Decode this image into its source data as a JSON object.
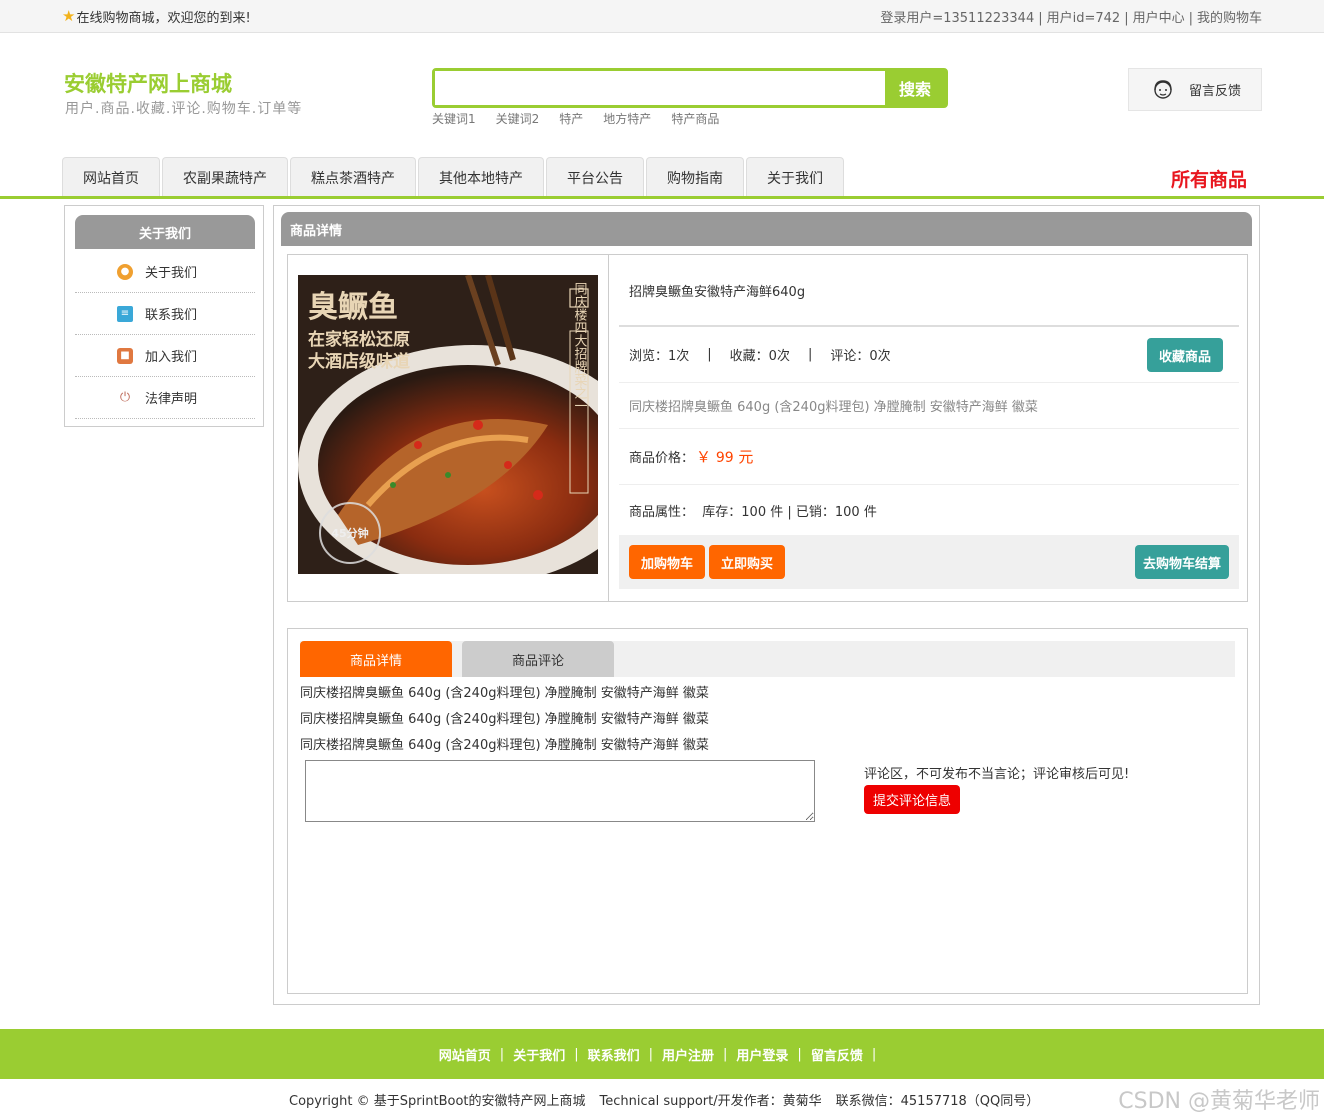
{
  "topbar": {
    "welcome": "在线购物商城，欢迎您的到来!",
    "links": [
      "登录用户=13511223344",
      "用户id=742",
      "用户中心",
      "我的购物车"
    ]
  },
  "header": {
    "title": "安徽特产网上商城",
    "subtitle": "用户.商品.收藏.评论.购物车.订单等",
    "search_value": "",
    "search_button": "搜索",
    "keywords": [
      "关键词1",
      "关键词2",
      "特产",
      "地方特产",
      "特产商品"
    ],
    "feedback": "留言反馈"
  },
  "nav": {
    "tabs": [
      "网站首页",
      "农副果蔬特产",
      "糕点茶酒特产",
      "其他本地特产",
      "平台公告",
      "购物指南",
      "关于我们"
    ],
    "all_goods": "所有商品"
  },
  "sidebar": {
    "title": "关于我们",
    "items": [
      {
        "label": "关于我们",
        "icon": "coin-icon",
        "color": "#f0a030"
      },
      {
        "label": "联系我们",
        "icon": "clipboard-icon",
        "color": "#3aa8d8"
      },
      {
        "label": "加入我们",
        "icon": "lock-icon",
        "color": "#e07840"
      },
      {
        "label": "法律声明",
        "icon": "power-icon",
        "color": "#c07060"
      }
    ]
  },
  "main": {
    "title": "商品详情",
    "product": {
      "name": "招牌臭鳜鱼安徽特产海鲜640g",
      "views_label": "浏览：1次",
      "favorites_label": "收藏：0次",
      "comments_label": "评论：0次",
      "collect_button": "收藏商品",
      "description": "同庆楼招牌臭鳜鱼 640g (含240g料理包) 净膛腌制 安徽特产海鲜 徽菜",
      "price_label": "商品价格：",
      "price_symbol": "￥",
      "price_value": "99",
      "price_unit": "元",
      "attr_label": "商品属性：",
      "attr_value": "库存：100 件 | 已销：100 件",
      "add_cart_button": "加购物车",
      "buy_now_button": "立即购买",
      "checkout_button": "去购物车结算",
      "image_text": {
        "title": "臭鳜鱼",
        "line1": "在家轻松还原",
        "line2": "大酒店级味道",
        "vertical": "同庆楼四大招牌菜之一",
        "badge": "45分钟"
      }
    },
    "tabs": {
      "active": "商品详情",
      "inactive": "商品评论"
    },
    "desc_lines": [
      "同庆楼招牌臭鳜鱼 640g (含240g料理包) 净膛腌制 安徽特产海鲜 徽菜",
      "同庆楼招牌臭鳜鱼 640g (含240g料理包) 净膛腌制 安徽特产海鲜 徽菜",
      "同庆楼招牌臭鳜鱼 640g (含240g料理包) 净膛腌制 安徽特产海鲜 徽菜"
    ],
    "comment": {
      "value": "",
      "note": "评论区，不可发布不当言论；评论审核后可见!",
      "submit": "提交评论信息"
    }
  },
  "footer": {
    "links": [
      "网站首页",
      "关于我们",
      "联系我们",
      "用户注册",
      "用户登录",
      "留言反馈"
    ],
    "copyright": "Copyright © 基于SprintBoot的安徽特产网上商城",
    "support": "Technical support/开发作者：黄菊华",
    "contact": "联系微信：45157718（QQ同号）",
    "watermark": "CSDN @黄菊华老师"
  },
  "colors": {
    "brand_green": "#9acd32",
    "orange": "#ff6600",
    "teal": "#36a09a",
    "red": "#e8171f"
  }
}
